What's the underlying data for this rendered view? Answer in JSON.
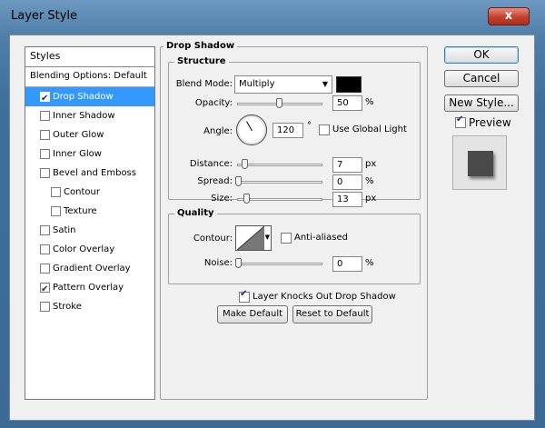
{
  "window": {
    "title": "Layer Style",
    "close_glyph": "x"
  },
  "styles_list": {
    "header": "Styles",
    "blending_options": "Blending Options: Default",
    "items": [
      {
        "label": "Drop Shadow",
        "checked": true,
        "selected": true,
        "sub": false
      },
      {
        "label": "Inner Shadow",
        "checked": false,
        "selected": false,
        "sub": false
      },
      {
        "label": "Outer Glow",
        "checked": false,
        "selected": false,
        "sub": false
      },
      {
        "label": "Inner Glow",
        "checked": false,
        "selected": false,
        "sub": false
      },
      {
        "label": "Bevel and Emboss",
        "checked": false,
        "selected": false,
        "sub": false
      },
      {
        "label": "Contour",
        "checked": false,
        "selected": false,
        "sub": true
      },
      {
        "label": "Texture",
        "checked": false,
        "selected": false,
        "sub": true
      },
      {
        "label": "Satin",
        "checked": false,
        "selected": false,
        "sub": false
      },
      {
        "label": "Color Overlay",
        "checked": false,
        "selected": false,
        "sub": false
      },
      {
        "label": "Gradient Overlay",
        "checked": false,
        "selected": false,
        "sub": false
      },
      {
        "label": "Pattern Overlay",
        "checked": true,
        "selected": false,
        "sub": false
      },
      {
        "label": "Stroke",
        "checked": false,
        "selected": false,
        "sub": false
      }
    ]
  },
  "drop_shadow": {
    "title": "Drop Shadow",
    "structure": {
      "title": "Structure",
      "blend_mode_label": "Blend Mode:",
      "blend_mode_value": "Multiply",
      "shadow_color": "#000000",
      "opacity_label": "Opacity:",
      "opacity_value": "50",
      "opacity_unit": "%",
      "opacity_fraction": 0.5,
      "angle_label": "Angle:",
      "angle_value": "120",
      "angle_unit": "°",
      "use_global_light_label": "Use Global Light",
      "use_global_light_checked": false,
      "distance_label": "Distance:",
      "distance_value": "7",
      "distance_unit": "px",
      "spread_label": "Spread:",
      "spread_value": "0",
      "spread_unit": "%",
      "size_label": "Size:",
      "size_value": "13",
      "size_unit": "px"
    },
    "quality": {
      "title": "Quality",
      "contour_label": "Contour:",
      "anti_aliased_label": "Anti-aliased",
      "anti_aliased_checked": false,
      "noise_label": "Noise:",
      "noise_value": "0",
      "noise_unit": "%"
    },
    "knocks_out_label": "Layer Knocks Out Drop Shadow",
    "knocks_out_checked": true,
    "make_default_label": "Make Default",
    "reset_default_label": "Reset to Default"
  },
  "buttons": {
    "ok": "OK",
    "cancel": "Cancel",
    "new_style": "New Style...",
    "preview_label": "Preview",
    "preview_checked": true
  },
  "icons": {
    "dropdown": "chevron-down-icon",
    "checkmark": "checkmark-icon"
  }
}
